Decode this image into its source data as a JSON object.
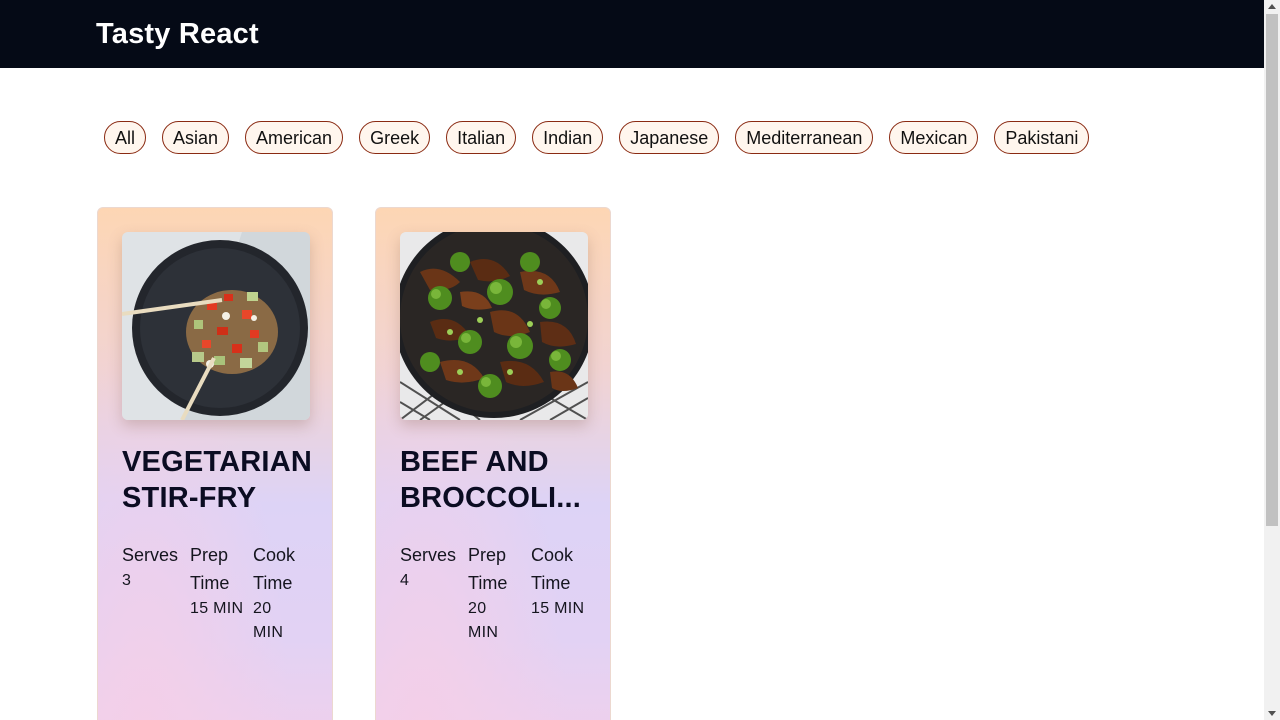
{
  "header": {
    "brand": "Tasty React"
  },
  "filters": [
    "All",
    "Asian",
    "American",
    "Greek",
    "Italian",
    "Indian",
    "Japanese",
    "Mediterranean",
    "Mexican",
    "Pakistani"
  ],
  "recipes": [
    {
      "title_line1": "VEGETARIAN",
      "title_line2": "STIR-FRY",
      "image": "stir-fry-bowl-photo",
      "serves_label": "Serves",
      "serves": "3",
      "prep_label_1": "Prep",
      "prep_label_2": "Time",
      "prep_value": "15 MIN",
      "cook_label_1": "Cook",
      "cook_label_2": "Time",
      "cook_value_1": "20",
      "cook_value_2": "MIN"
    },
    {
      "title_line1": "BEEF AND",
      "title_line2": "BROCCOLI...",
      "image": "beef-broccoli-skillet-photo",
      "serves_label": "Serves",
      "serves": "4",
      "prep_label_1": "Prep",
      "prep_label_2": "Time",
      "prep_value_1": "20",
      "prep_value_2": "MIN",
      "cook_label_1": "Cook",
      "cook_label_2": "Time",
      "cook_value": "15 MIN"
    }
  ],
  "colors": {
    "header_bg": "#050a16",
    "chip_border": "#8a2a12",
    "chip_bg": "#fff6ee",
    "title_text": "#0b0c22"
  }
}
